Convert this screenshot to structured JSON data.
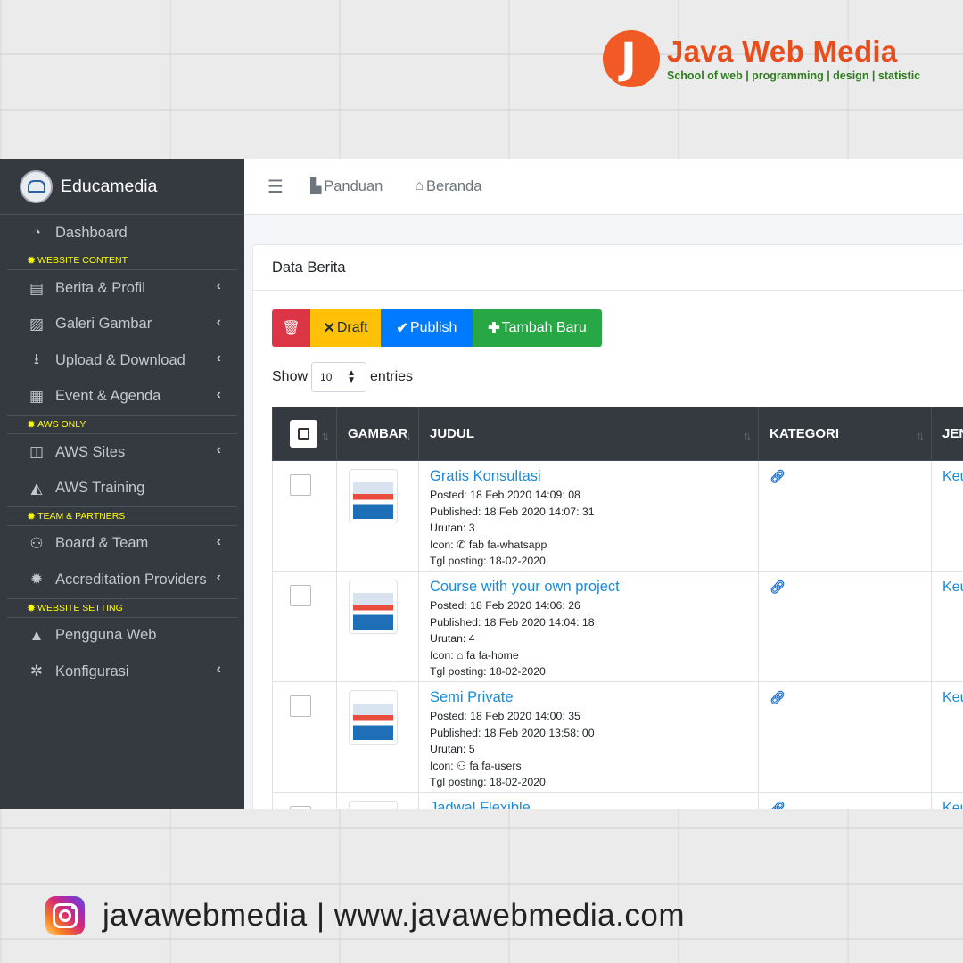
{
  "brand": {
    "name": "Java Web Media",
    "tagline": "School of web | programming | design | statistic",
    "mark": "J",
    "color": "#f15a24"
  },
  "sidebar": {
    "title": "Educamedia",
    "items": [
      {
        "type": "item",
        "label": "Dashboard",
        "icon": "tachometer-icon",
        "glyph": "◔",
        "chevron": false
      },
      {
        "type": "header",
        "label": "WEBSITE CONTENT"
      },
      {
        "type": "item",
        "label": "Berita & Profil",
        "icon": "newspaper-icon",
        "glyph": "▤",
        "chevron": true
      },
      {
        "type": "item",
        "label": "Galeri Gambar",
        "icon": "image-icon",
        "glyph": "▨",
        "chevron": true
      },
      {
        "type": "item",
        "label": "Upload & Download",
        "icon": "download-icon",
        "glyph": "⭳",
        "chevron": true
      },
      {
        "type": "item",
        "label": "Event & Agenda",
        "icon": "calendar-icon",
        "glyph": "▦",
        "chevron": true
      },
      {
        "type": "header",
        "label": "AWS ONLY"
      },
      {
        "type": "item",
        "label": "AWS Sites",
        "icon": "map-icon",
        "glyph": "◫",
        "chevron": true
      },
      {
        "type": "item",
        "label": "AWS Training",
        "icon": "graduation-cap-icon",
        "glyph": "◭",
        "chevron": false
      },
      {
        "type": "header",
        "label": "TEAM & PARTNERS"
      },
      {
        "type": "item",
        "label": "Board & Team",
        "icon": "users-icon",
        "glyph": "⚇",
        "chevron": true
      },
      {
        "type": "item",
        "label": "Accreditation Providers",
        "icon": "certificate-icon",
        "glyph": "✹",
        "chevron": true
      },
      {
        "type": "header",
        "label": "WEBSITE SETTING"
      },
      {
        "type": "item",
        "label": "Pengguna Web",
        "icon": "lock-icon",
        "glyph": "▲",
        "chevron": false
      },
      {
        "type": "item",
        "label": "Konfigurasi",
        "icon": "cog-icon",
        "glyph": "✲",
        "chevron": true
      }
    ]
  },
  "navbar": {
    "toggle_glyph": "☰",
    "links": [
      {
        "label": "Panduan",
        "icon": "file-pdf-icon",
        "glyph": "▙"
      },
      {
        "label": "Beranda",
        "icon": "home-icon",
        "glyph": "⌂"
      }
    ]
  },
  "card": {
    "title": "Data Berita",
    "buttons": {
      "delete_glyph": "🗑",
      "draft": "Draft",
      "draft_glyph": "✕",
      "publish": "Publish",
      "publish_glyph": "✔",
      "add": "Tambah Baru",
      "add_glyph": "✚"
    },
    "entries": {
      "show": "Show",
      "value": "10",
      "suffix": "entries"
    }
  },
  "table": {
    "columns": [
      "GAMBAR",
      "JUDUL",
      "KATEGORI",
      "JEN"
    ],
    "rows": [
      {
        "title": "Gratis Konsultasi",
        "posted": "Posted: 18 Feb 2020 14:09: 08",
        "published": "Published: 18 Feb 2020 14:07: 31",
        "urutan": "Urutan: 3",
        "icon_glyph": "✆",
        "icon_text": "fab fa-whatsapp",
        "tgl": "Tgl posting: 18-02-2020",
        "jenis": "Keu"
      },
      {
        "title": "Course with your own project",
        "posted": "Posted: 18 Feb 2020 14:06: 26",
        "published": "Published: 18 Feb 2020 14:04: 18",
        "urutan": "Urutan: 4",
        "icon_glyph": "⌂",
        "icon_text": "fa fa-home",
        "tgl": "Tgl posting: 18-02-2020",
        "jenis": "Keu"
      },
      {
        "title": "Semi Private",
        "posted": "Posted: 18 Feb 2020 14:00: 35",
        "published": "Published: 18 Feb 2020 13:58: 00",
        "urutan": "Urutan: 5",
        "icon_glyph": "⚇",
        "icon_text": "fa fa-users",
        "tgl": "Tgl posting: 18-02-2020",
        "jenis": "Keu"
      },
      {
        "title": "Jadwal Flexible",
        "posted": "",
        "published": "",
        "urutan": "",
        "icon_glyph": "",
        "icon_text": "",
        "tgl": "",
        "jenis": "Keu"
      }
    ]
  },
  "footer": {
    "text": "javawebmedia | www.javawebmedia.com",
    "icon": "instagram-icon"
  }
}
